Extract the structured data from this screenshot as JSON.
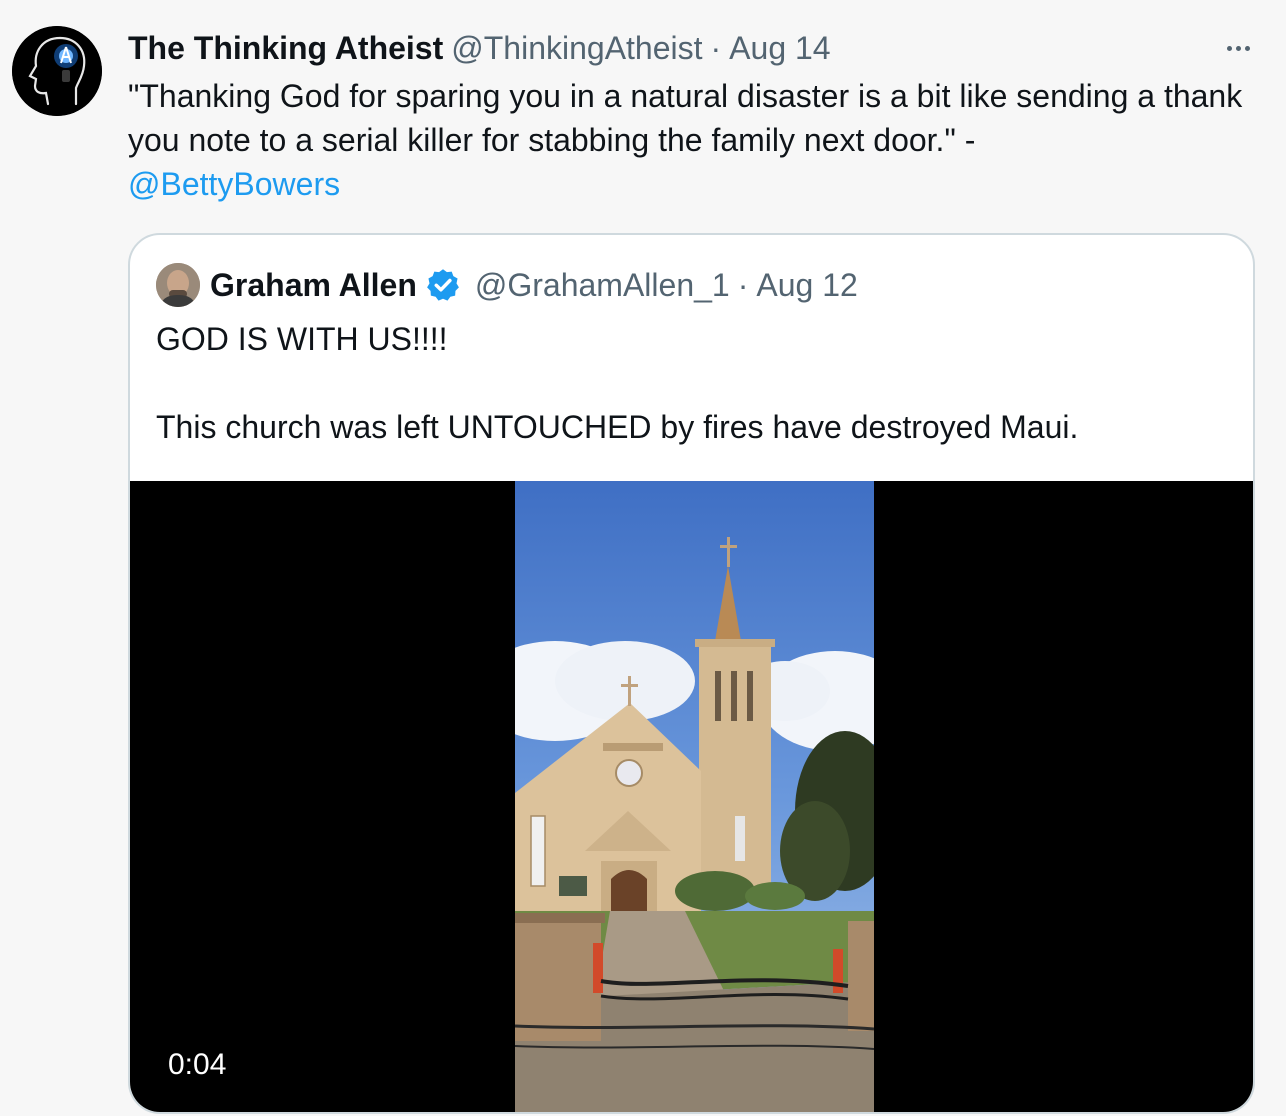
{
  "tweet": {
    "display_name": "The Thinking Atheist",
    "handle": "@ThinkingAtheist",
    "separator": "·",
    "date": "Aug 14",
    "text_main": "\"Thanking God for sparing you in a natural disaster is a bit like sending a thank you note to a serial killer for stabbing the family next door.\" -",
    "mention": "@BettyBowers",
    "more_icon": "ellipsis-icon"
  },
  "quoted": {
    "display_name": "Graham Allen",
    "verified_icon": "verified-badge-icon",
    "handle": "@GrahamAllen_1",
    "separator": "·",
    "date": "Aug 12",
    "text": "GOD IS WITH US!!!!\n\nThis church was left UNTOUCHED by fires have destroyed Maui.",
    "video": {
      "timestamp": "0:04"
    }
  },
  "colors": {
    "accent": "#1d9bf0",
    "muted": "#536471",
    "background": "#f7f7f7",
    "border": "#cfd9de"
  }
}
